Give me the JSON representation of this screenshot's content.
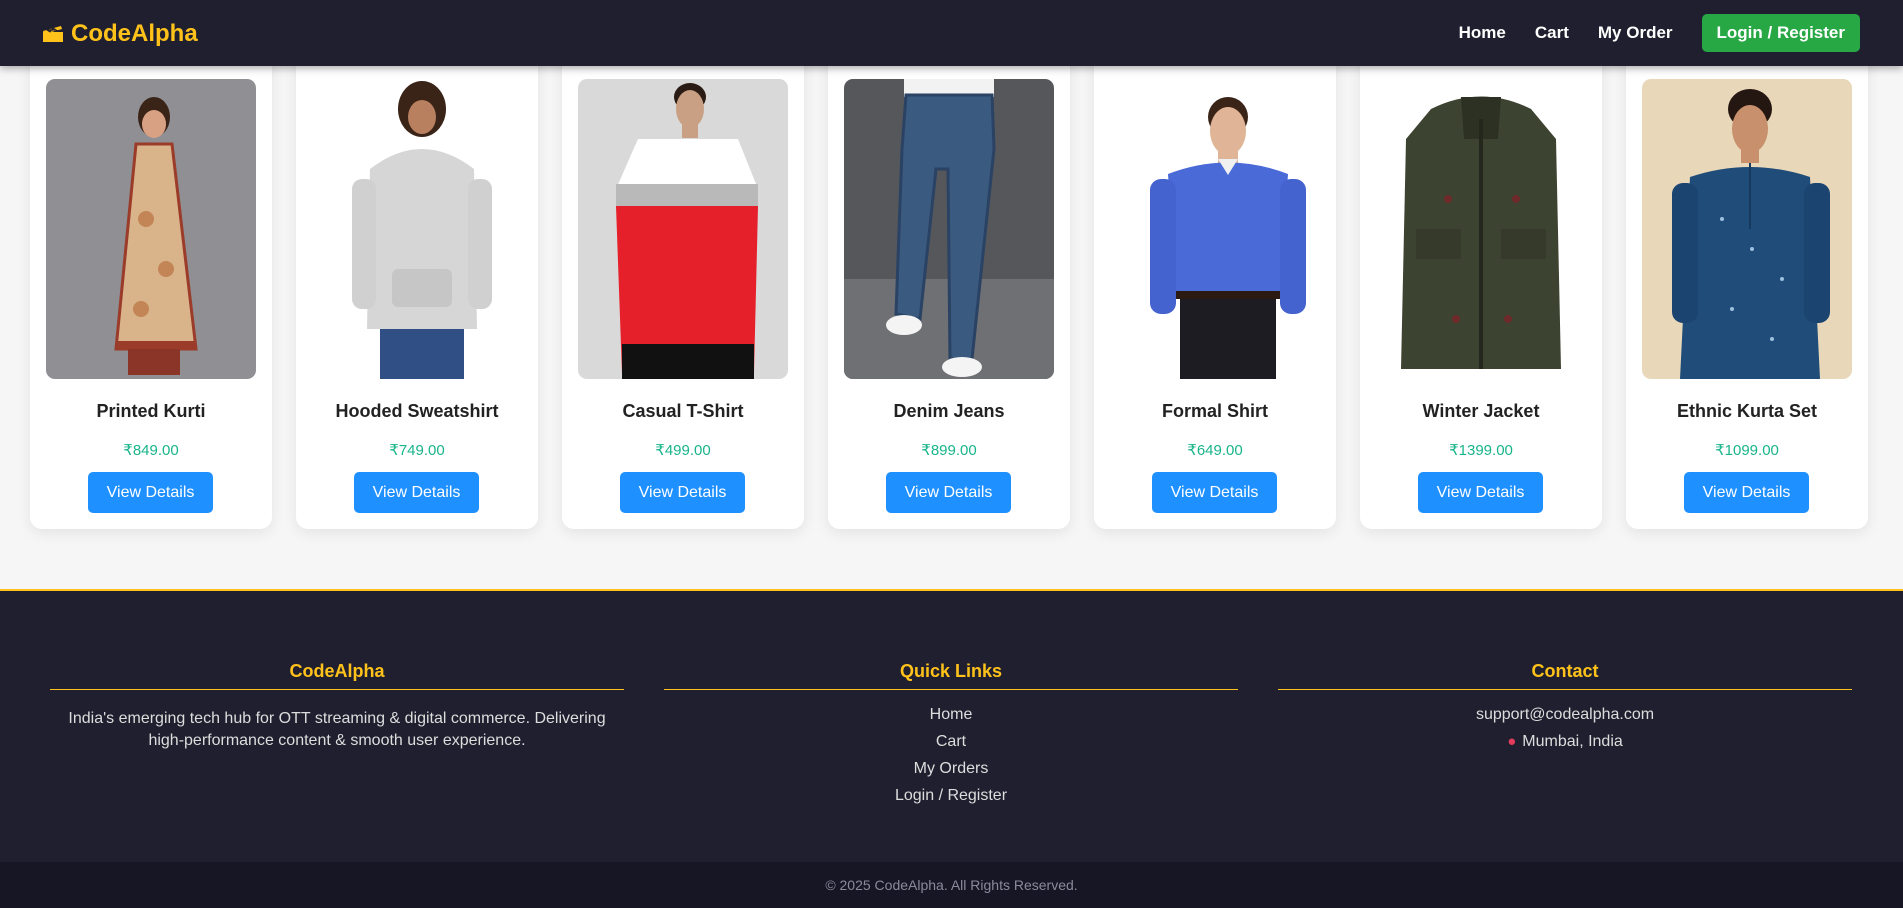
{
  "nav": {
    "brand": "CodeAlpha",
    "links": [
      "Home",
      "Cart",
      "My Order"
    ],
    "login_label": "Login / Register"
  },
  "products": [
    {
      "name": "Printed Kurti",
      "price": "₹849.00",
      "button": "View Details"
    },
    {
      "name": "Hooded Sweatshirt",
      "price": "₹749.00",
      "button": "View Details"
    },
    {
      "name": "Casual T-Shirt",
      "price": "₹499.00",
      "button": "View Details"
    },
    {
      "name": "Denim Jeans",
      "price": "₹899.00",
      "button": "View Details"
    },
    {
      "name": "Formal Shirt",
      "price": "₹649.00",
      "button": "View Details"
    },
    {
      "name": "Winter Jacket",
      "price": "₹1399.00",
      "button": "View Details"
    },
    {
      "name": "Ethnic Kurta Set",
      "price": "₹1099.00",
      "button": "View Details"
    }
  ],
  "footer": {
    "about": {
      "title": "CodeAlpha",
      "text": "India's emerging tech hub for OTT streaming & digital commerce. Delivering high-performance content & smooth user experience."
    },
    "quick_links": {
      "title": "Quick Links",
      "items": [
        "Home",
        "Cart",
        "My Orders",
        "Login / Register"
      ]
    },
    "contact": {
      "title": "Contact",
      "email": "support@codealpha.com",
      "location": "Mumbai, India"
    },
    "copyright": "© 2025 CodeAlpha. All Rights Reserved."
  },
  "colors": {
    "nav_bg": "#1f1f2f",
    "accent": "#ffc21a",
    "login_green": "#28a745",
    "button_blue": "#1e90ff",
    "price_green": "#18b58a"
  },
  "icons": {
    "brand": "clapper-board-icon",
    "location": "pin-icon"
  }
}
